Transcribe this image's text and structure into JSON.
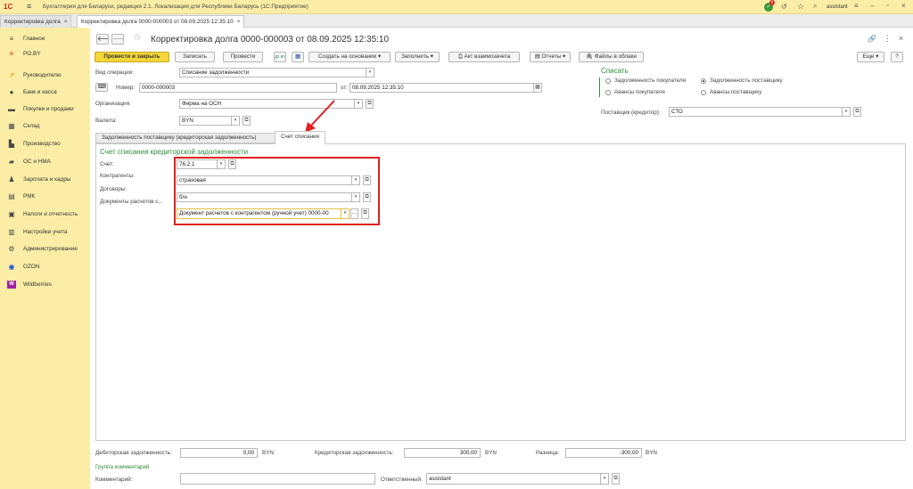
{
  "app": {
    "title": "Бухгалтерия для Беларуси, редакция 2.1. Локализация для Республики Беларусь   (1С:Предприятие)",
    "logo": "1С",
    "notifications_count": "6",
    "user": "assistant"
  },
  "tabs": [
    {
      "label": "Корректировка долга"
    },
    {
      "label": "Корректировка долга 0000-000003 от 08.09.2025 12:35:10"
    }
  ],
  "sidebar": {
    "items": [
      {
        "label": "Главное",
        "icon": "menu-icon"
      },
      {
        "label": "PO.BY",
        "icon": "poby-icon"
      },
      {
        "label": "Руководителю",
        "icon": "chart-icon"
      },
      {
        "label": "Банк и касса",
        "icon": "bank-icon"
      },
      {
        "label": "Покупки и продажи",
        "icon": "cart-icon"
      },
      {
        "label": "Склад",
        "icon": "warehouse-icon"
      },
      {
        "label": "Производство",
        "icon": "factory-icon"
      },
      {
        "label": "ОС и НМА",
        "icon": "truck-icon"
      },
      {
        "label": "Зарплата и кадры",
        "icon": "person-icon"
      },
      {
        "label": "РМК",
        "icon": "register-icon"
      },
      {
        "label": "Налоги и отчетность",
        "icon": "taxes-icon"
      },
      {
        "label": "Настройки учета",
        "icon": "settings-doc-icon"
      },
      {
        "label": "Администрирование",
        "icon": "gear-icon"
      },
      {
        "label": "OZON",
        "icon": "ozon-icon"
      },
      {
        "label": "Wildberries",
        "icon": "wildberries-icon"
      }
    ]
  },
  "document": {
    "title": "Корректировка долга 0000-000003 от 08.09.2025 12:35:10"
  },
  "toolbar": {
    "post_close": "Провести и закрыть",
    "save": "Записать",
    "post": "Провести",
    "create_based": "Создать на основании",
    "fill": "Заполнить",
    "act": "Акт взаимозачета",
    "reports": "Отчеты",
    "files": "Файлы в облаке",
    "more": "Еще",
    "help": "?",
    "dt_kt": "Дт Кт"
  },
  "form": {
    "operation_label": "Вид операции:",
    "operation_value": "Списание задолженности",
    "number_label": "Номер:",
    "number_value": "0000-000003",
    "date_label": "от:",
    "date_value": "08.09.2025 12:35:10",
    "org_label": "Организация:",
    "org_value": "Фирма на ОСН",
    "currency_label": "Валюта:",
    "currency_value": "BYN",
    "writeoff_title": "Списать",
    "radio_buyer_debt": "Задолженность покупателя",
    "radio_supplier_debt": "Задолженность поставщику",
    "radio_buyer_advances": "Авансы покупателя",
    "radio_supplier_advances": "Авансы поставщику",
    "supplier_label": "Поставщик (кредитор):",
    "supplier_value": "СТО"
  },
  "subtabs": [
    {
      "label": "Задолженность поставщику (кредиторская задолженность)"
    },
    {
      "label": "Счет списания"
    }
  ],
  "writeoff_account": {
    "heading": "Счет списания кредиторской задолженности",
    "account_label": "Счет:",
    "account_value": "76.2.1",
    "counterparty_label": "Контрагенты:",
    "counterparty_value": "страховая",
    "contract_label": "Договоры:",
    "contract_value": "б/н",
    "docs_label": "Документы расчетов с...",
    "docs_value": "Документ расчетов с контрагентом (ручной учет) 0000-00"
  },
  "footer": {
    "debit_label": "Дебиторская задолженность:",
    "debit_value": "0,00",
    "debit_cur": "BYN",
    "credit_label": "Кредиторская задолженность:",
    "credit_value": "300,00",
    "credit_cur": "BYN",
    "diff_label": "Разница:",
    "diff_value": "-300,00",
    "diff_cur": "BYN",
    "comments_group": "Группа комментарий",
    "comment_label": "Комментарий:",
    "comment_value": "",
    "responsible_label": "Ответственный:",
    "responsible_value": "assistant"
  },
  "colors": {
    "topbar": "#fbeda5",
    "primary_button": "#f5d63a",
    "accent_green": "#2e8b3a",
    "highlight_red": "#e02020"
  }
}
